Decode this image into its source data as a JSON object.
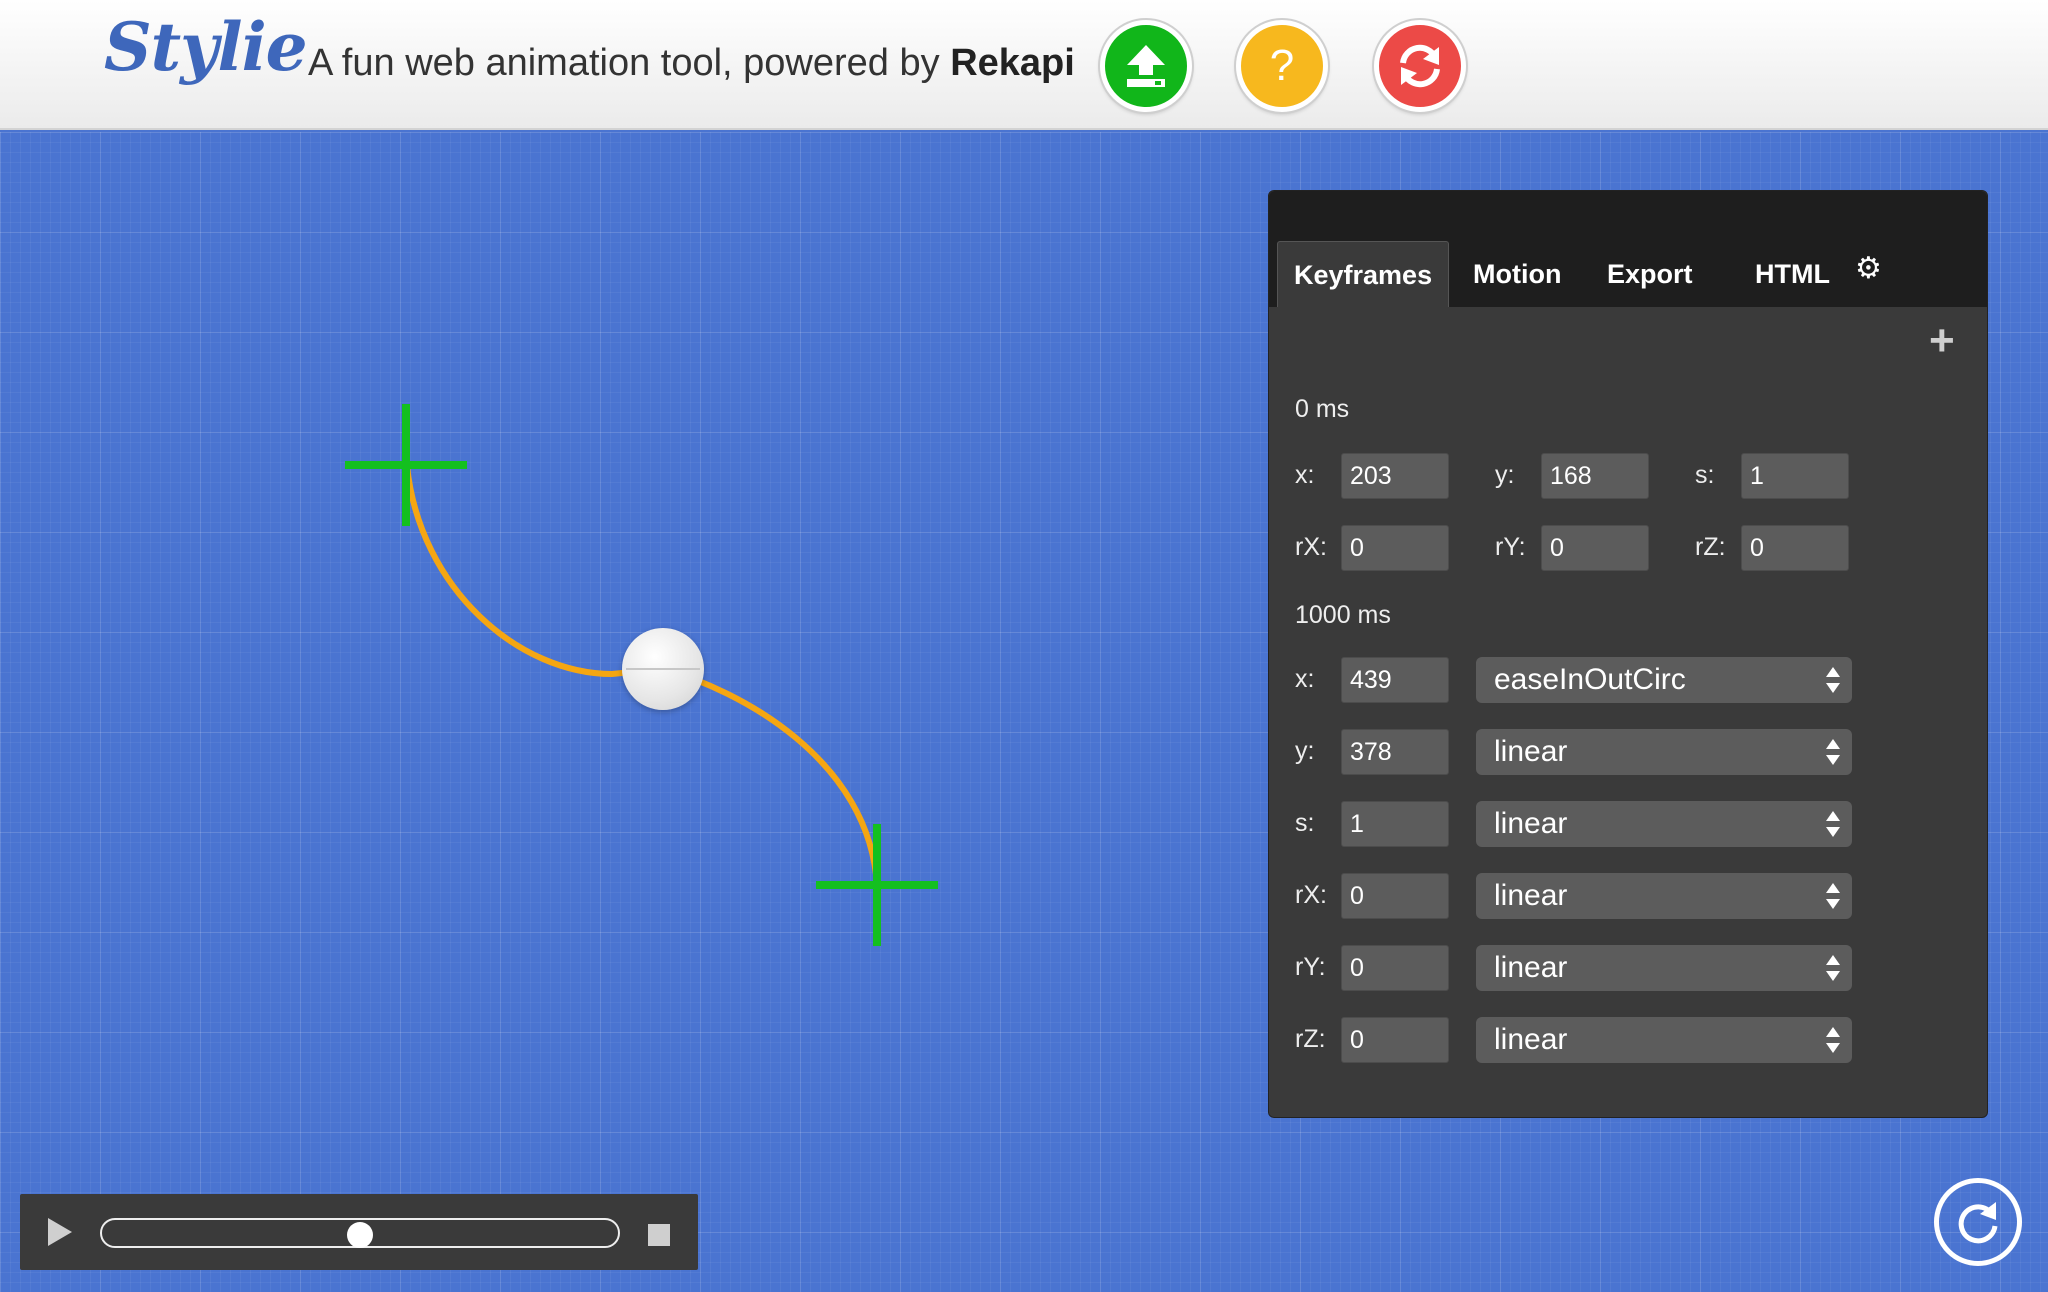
{
  "app": {
    "logo": "Stylie",
    "tagline_prefix": "A fun web animation tool, powered by",
    "tagline_brand": "Rekapi"
  },
  "header_buttons": [
    {
      "name": "upload",
      "icon": "upload-icon",
      "color": "#11b61a"
    },
    {
      "name": "help",
      "icon": "question-icon",
      "label": "?",
      "color": "#f7b81e"
    },
    {
      "name": "refresh",
      "icon": "refresh-icon",
      "color": "#ec4a47"
    }
  ],
  "panel": {
    "tabs": [
      "Keyframes",
      "Motion",
      "Export",
      "HTML"
    ],
    "active_tab": "Keyframes",
    "settings_icon": "gear-icon",
    "add_icon": "plus-icon",
    "keyframes": [
      {
        "time_label": "0 ms",
        "fields": {
          "x": "203",
          "y": "168",
          "s": "1",
          "rX": "0",
          "rY": "0",
          "rZ": "0"
        }
      },
      {
        "time_label": "1000 ms",
        "rows": [
          {
            "label": "x:",
            "value": "439",
            "easing": "easeInOutCirc"
          },
          {
            "label": "y:",
            "value": "378",
            "easing": "linear"
          },
          {
            "label": "s:",
            "value": "1",
            "easing": "linear"
          },
          {
            "label": "rX:",
            "value": "0",
            "easing": "linear"
          },
          {
            "label": "rY:",
            "value": "0",
            "easing": "linear"
          },
          {
            "label": "rZ:",
            "value": "0",
            "easing": "linear"
          }
        ]
      }
    ]
  },
  "labels": {
    "x": "x:",
    "y": "y:",
    "s": "s:",
    "rX": "rX:",
    "rY": "rY:",
    "rZ": "rZ:"
  },
  "playback": {
    "progress": 0.5,
    "play_icon": "play-icon",
    "stop_icon": "stop-icon"
  },
  "colors": {
    "path": "#f5a612",
    "crosshair": "#14c01f",
    "stage": "#4a74d1",
    "panel": "#3a3a3a"
  }
}
